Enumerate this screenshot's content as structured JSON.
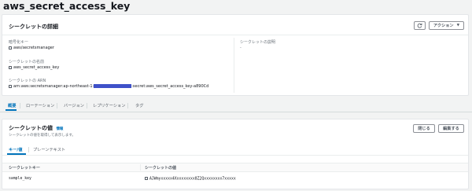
{
  "page_title": "aws_secret_access_key",
  "details": {
    "title": "シークレットの詳細",
    "refresh_icon": "refresh-icon",
    "actions_label": "アクション",
    "encryption_key_label": "暗号化キー",
    "encryption_key_value": "aws/secretsmanager",
    "secret_name_label": "シークレットの名前",
    "secret_name_value": "aws_secret_access_key",
    "arn_label": "シークレットの ARN",
    "arn_prefix": "arn:aws:secretsmanager:ap-northeast-1:",
    "arn_suffix": ":secret:aws_secret_access_key-a890Cd",
    "description_label": "シークレットの説明",
    "description_value": "-"
  },
  "tabs": [
    {
      "label": "概要"
    },
    {
      "label": "ローテーション"
    },
    {
      "label": "バージョン"
    },
    {
      "label": "レプリケーション"
    },
    {
      "label": "タグ"
    }
  ],
  "secret_value": {
    "title": "シークレットの値",
    "info_label": "情報",
    "subtitle": "シークレットの値を取得して表示します。",
    "close_label": "閉じる",
    "edit_label": "編集する",
    "subtabs": [
      {
        "label": "キー/値"
      },
      {
        "label": "プレーンテキスト"
      }
    ],
    "col_key": "シークレットキー",
    "col_value": "シークレットの値",
    "row_key": "sample_key",
    "row_value": "AJWmyxxxxx4Xxxxxxxxx8Z2Qxxxxxxxx7xxxxx"
  }
}
